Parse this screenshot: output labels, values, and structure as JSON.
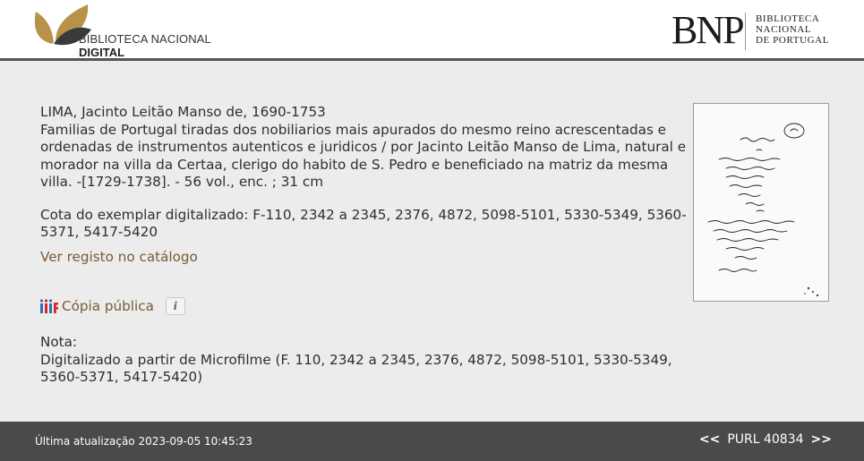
{
  "header": {
    "left_logo": {
      "line1": "BIBLIOTECA NACIONAL",
      "line2": "DIGITAL",
      "leaf_color": "#b89248"
    },
    "right_logo": {
      "letters": "BNP",
      "line1": "BIBLIOTECA",
      "line2": "NACIONAL",
      "line3": "DE PORTUGAL"
    }
  },
  "record": {
    "author": "LIMA, Jacinto Leitão Manso de, 1690-1753",
    "description": "Familias de Portugal tiradas dos nobiliarios mais apurados do mesmo reino acrescentadas e ordenadas de instrumentos autenticos e juridicos / por Jacinto Leitão Manso de Lima, natural e morador na villa da Certaa, clerigo do habito de S. Pedro e beneficiado na matriz da mesma villa. -[1729-1738]. - 56 vol., enc. ; 31 cm",
    "cota": "Cota do exemplar digitalizado: F-110, 2342 a 2345, 2376, 4872, 5098-5101, 5330-5349, 5360-5371, 5417-5420",
    "catalog_link": "Ver registo no catálogo",
    "public_copy": "Cópia pública",
    "public_copy_icon": "iiif-icon",
    "info_icon": "info-icon",
    "note_label": "Nota:",
    "note_text": "Digitalizado a partir de Microfilme (F. 110, 2342 a 2345, 2376, 4872, 5098-5101, 5330-5349, 5360-5371, 5417-5420)"
  },
  "footer": {
    "updated": "Última atualização 2023-09-05 10:45:23",
    "prev": "<<",
    "purl": "PURL 40834",
    "next": ">>"
  },
  "colors": {
    "link": "#7a5b36",
    "footer_bg": "#4a4a4a",
    "page_bg": "#ececec"
  }
}
